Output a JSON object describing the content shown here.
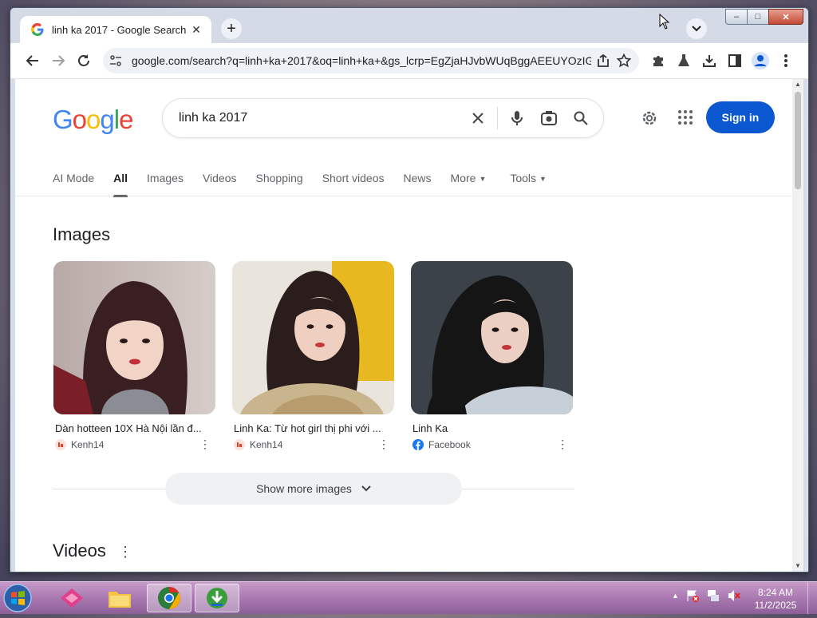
{
  "browser": {
    "tab_title": "linh ka 2017 - Google Search",
    "tab_close": "✕",
    "new_tab": "+",
    "url": "google.com/search?q=linh+ka+2017&oq=linh+ka+&gs_lcrp=EgZjaHJvbWUqBggAEEUYOzIG...",
    "window_controls": {
      "minimize": "‒",
      "maximize": "□",
      "close": "✕"
    }
  },
  "google": {
    "logo_letters": [
      "G",
      "o",
      "o",
      "g",
      "l",
      "e"
    ],
    "logo_colors": [
      "#4285F4",
      "#EA4335",
      "#FBBC05",
      "#4285F4",
      "#34A853",
      "#EA4335"
    ],
    "query": "linh ka 2017",
    "sign_in": "Sign in",
    "tabs": [
      {
        "label": "AI Mode"
      },
      {
        "label": "All"
      },
      {
        "label": "Images"
      },
      {
        "label": "Videos"
      },
      {
        "label": "Shopping"
      },
      {
        "label": "Short videos"
      },
      {
        "label": "News"
      },
      {
        "label": "More"
      },
      {
        "label": "Tools"
      }
    ],
    "images_heading": "Images",
    "images": [
      {
        "caption": "Dàn hotteen 10X Hà Nội lần đ...",
        "source": "Kenh14",
        "more": "⋮"
      },
      {
        "caption": "Linh Ka: Từ hot girl thị phi với ...",
        "source": "Kenh14",
        "more": "⋮"
      },
      {
        "caption": "Linh Ka",
        "source": "Facebook",
        "more": "⋮"
      }
    ],
    "show_more": "Show more images",
    "videos_heading": "Videos",
    "videos_more": "⋮"
  },
  "taskbar": {
    "clock_time": "8:24 AM",
    "clock_date": "11/2/2025",
    "tray_arrow": "▲"
  },
  "colors": {
    "accent": "#0b57d0",
    "active_tab_underline": "#202124"
  }
}
